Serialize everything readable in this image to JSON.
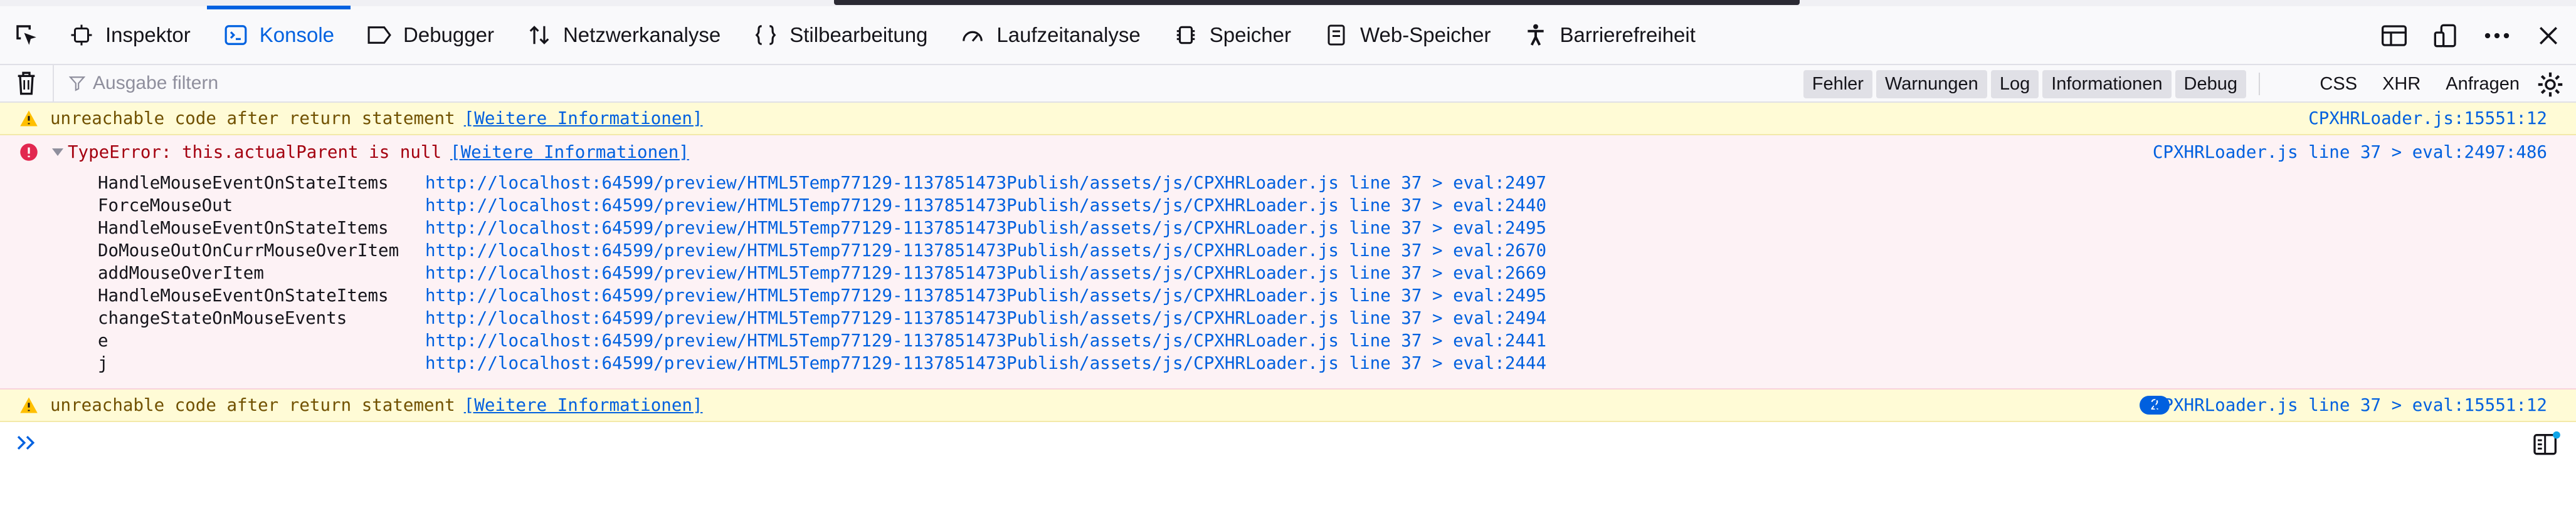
{
  "tabs": [
    {
      "label": "Inspektor",
      "icon": "inspector-icon"
    },
    {
      "label": "Konsole",
      "icon": "console-icon",
      "active": true
    },
    {
      "label": "Debugger",
      "icon": "debugger-icon"
    },
    {
      "label": "Netzwerkanalyse",
      "icon": "network-icon"
    },
    {
      "label": "Stilbearbeitung",
      "icon": "style-editor-icon"
    },
    {
      "label": "Laufzeitanalyse",
      "icon": "performance-icon"
    },
    {
      "label": "Speicher",
      "icon": "memory-icon"
    },
    {
      "label": "Web-Speicher",
      "icon": "storage-icon"
    },
    {
      "label": "Barrierefreiheit",
      "icon": "accessibility-icon"
    }
  ],
  "filter": {
    "placeholder": "Ausgabe filtern",
    "levels": [
      "Fehler",
      "Warnungen",
      "Log",
      "Informationen",
      "Debug"
    ],
    "extras": [
      "CSS",
      "XHR",
      "Anfragen"
    ]
  },
  "messages": {
    "warn1": {
      "text": "unreachable code after return statement",
      "more": "[Weitere Informationen]",
      "location": "CPXHRLoader.js:15551:12"
    },
    "error": {
      "text": "TypeError: this.actualParent is null",
      "more": "[Weitere Informationen]",
      "location": "CPXHRLoader.js line 37 > eval:2497:486",
      "stack": [
        {
          "fn": "HandleMouseEventOnStateItems",
          "url": "http://localhost:64599/preview/HTML5Temp77129-1137851473Publish/assets/js/CPXHRLoader.js line 37 > eval:2497"
        },
        {
          "fn": "ForceMouseOut",
          "url": "http://localhost:64599/preview/HTML5Temp77129-1137851473Publish/assets/js/CPXHRLoader.js line 37 > eval:2440"
        },
        {
          "fn": "HandleMouseEventOnStateItems",
          "url": "http://localhost:64599/preview/HTML5Temp77129-1137851473Publish/assets/js/CPXHRLoader.js line 37 > eval:2495"
        },
        {
          "fn": "DoMouseOutOnCurrMouseOverItem",
          "url": "http://localhost:64599/preview/HTML5Temp77129-1137851473Publish/assets/js/CPXHRLoader.js line 37 > eval:2670"
        },
        {
          "fn": "addMouseOverItem",
          "url": "http://localhost:64599/preview/HTML5Temp77129-1137851473Publish/assets/js/CPXHRLoader.js line 37 > eval:2669"
        },
        {
          "fn": "HandleMouseEventOnStateItems",
          "url": "http://localhost:64599/preview/HTML5Temp77129-1137851473Publish/assets/js/CPXHRLoader.js line 37 > eval:2495"
        },
        {
          "fn": "changeStateOnMouseEvents",
          "url": "http://localhost:64599/preview/HTML5Temp77129-1137851473Publish/assets/js/CPXHRLoader.js line 37 > eval:2494"
        },
        {
          "fn": "e",
          "url": "http://localhost:64599/preview/HTML5Temp77129-1137851473Publish/assets/js/CPXHRLoader.js line 37 > eval:2441"
        },
        {
          "fn": "j",
          "url": "http://localhost:64599/preview/HTML5Temp77129-1137851473Publish/assets/js/CPXHRLoader.js line 37 > eval:2444"
        }
      ]
    },
    "warn2": {
      "text": "unreachable code after return statement",
      "more": "[Weitere Informationen]",
      "repeat": "2",
      "location": "CPXHRLoader.js line 37 > eval:15551:12"
    }
  },
  "colors": {
    "accent": "#0061e0",
    "warning_bg": "#fffbd6",
    "error_bg": "#fdf2f5",
    "error_text": "#a4000f",
    "warning_text": "#715100"
  }
}
